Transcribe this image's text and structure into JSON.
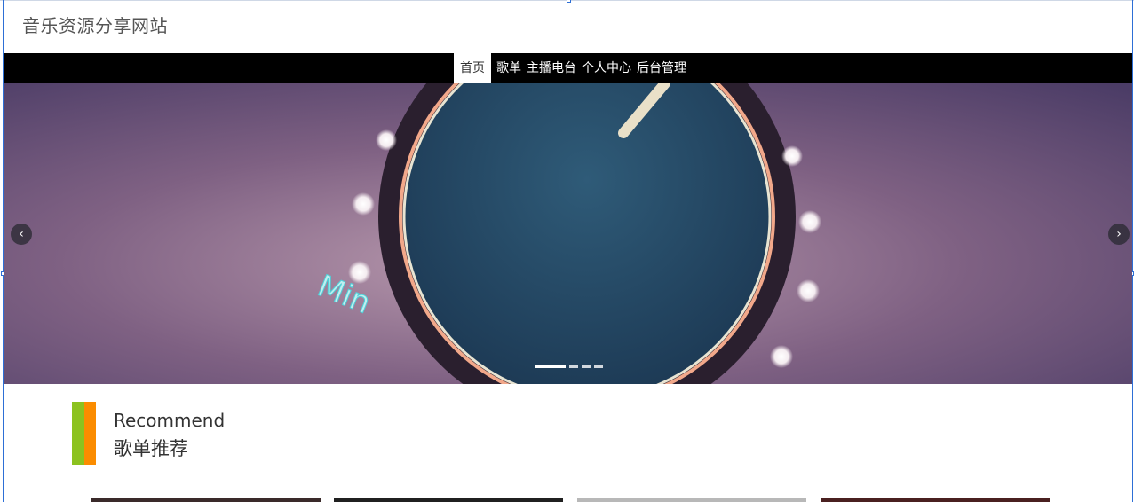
{
  "site": {
    "title": "音乐资源分享网站"
  },
  "nav": {
    "items": [
      {
        "label": "首页",
        "active": true
      },
      {
        "label": "歌单",
        "active": false
      },
      {
        "label": "主播电台",
        "active": false
      },
      {
        "label": "个人中心",
        "active": false
      },
      {
        "label": "后台管理",
        "active": false
      }
    ]
  },
  "carousel": {
    "banner_text": "Min",
    "prev_icon": "chevron-left-icon",
    "next_icon": "chevron-right-icon",
    "prev_glyph": "‹",
    "next_glyph": "›",
    "slide_count": 4,
    "active_slide": 1
  },
  "section": {
    "title_en": "Recommend",
    "title_cn": "歌单推荐",
    "accent_colors": [
      "#8cc21f",
      "#fb8c00"
    ]
  },
  "playlist_thumbs": [
    {
      "color": "#3a2a2a"
    },
    {
      "color": "#202020"
    },
    {
      "color": "#b8b8b8"
    },
    {
      "color": "#4a2020"
    }
  ]
}
